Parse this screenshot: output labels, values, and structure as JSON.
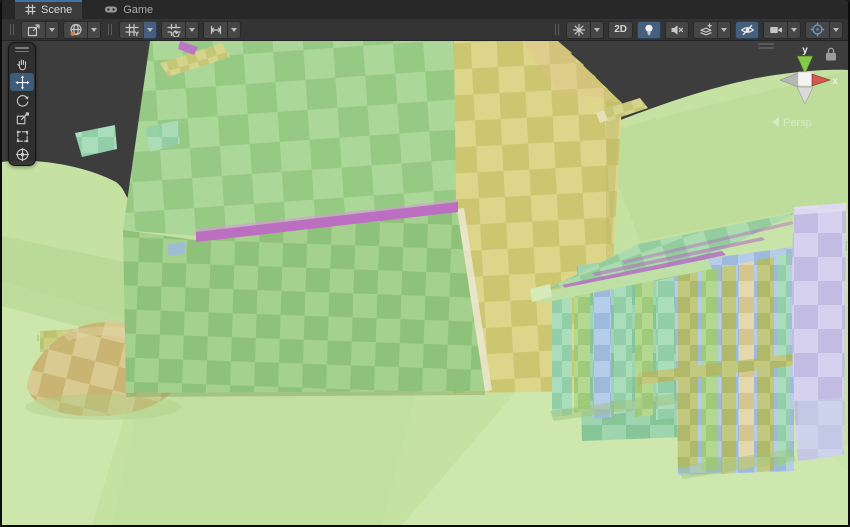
{
  "tabs": {
    "scene": {
      "label": "Scene",
      "active": true
    },
    "game": {
      "label": "Game",
      "active": false
    }
  },
  "scene_toolbar": {
    "tool_settings": {
      "pivot_button": {
        "icon": "pivot-icon",
        "has_dropdown": true
      },
      "orientation_button": {
        "icon": "globe-icon",
        "has_dropdown": true
      }
    },
    "grid_and_snap": {
      "grid_visibility": {
        "icon": "grid-icon",
        "dropdown_active": true
      },
      "grid_snapping": {
        "icon": "grid-snap-icon",
        "has_dropdown": true
      },
      "snap_increment": {
        "icon": "snap-increment-icon",
        "has_dropdown": true
      }
    },
    "view_options": {
      "draw_mode": {
        "icon": "burst-icon",
        "has_dropdown": true
      },
      "two_d": {
        "label": "2D",
        "active": false
      },
      "lighting": {
        "icon": "lightbulb-icon",
        "active": true
      },
      "audio": {
        "icon": "audio-muted-icon",
        "active": false
      },
      "effects": {
        "icon": "effects-icon",
        "has_dropdown": true
      },
      "visibility": {
        "icon": "eye-slash-icon",
        "active": true
      },
      "camera": {
        "icon": "camera-icon",
        "has_dropdown": true
      },
      "gizmos": {
        "icon": "gizmos-icon",
        "has_dropdown": true,
        "icon_color": "#5b9bd8"
      }
    }
  },
  "tools_overlay": {
    "items": [
      {
        "name": "view",
        "icon": "hand-icon",
        "active": false
      },
      {
        "name": "move",
        "icon": "move-icon",
        "active": true
      },
      {
        "name": "rotate",
        "icon": "rotate-icon",
        "active": false
      },
      {
        "name": "scale",
        "icon": "scale-icon",
        "active": false
      },
      {
        "name": "rect",
        "icon": "rect-icon",
        "active": false
      },
      {
        "name": "transform",
        "icon": "transform-icon",
        "active": false
      }
    ]
  },
  "gizmo": {
    "axis_y_label": "y",
    "axis_x_label": "x",
    "projection_label": "Persp",
    "axis_y_color": "#86c94a",
    "axis_x_color": "#cf5a50",
    "locked_icon": "lock-icon"
  },
  "viewport_scene": {
    "background_color": "#3d3d3d",
    "terrain_color": "#c5e2a3",
    "checker_visualization": true,
    "objects": [
      "terrain",
      "farmhouse",
      "shed-fence",
      "lavender-pillar",
      "stone-mound",
      "low-wall",
      "beams"
    ]
  },
  "colors": {
    "tab_active_accent": "#3e74ab",
    "toolbar_bg": "#333333",
    "button_bg": "#464646",
    "button_active_bg": "#44607e",
    "magenta_trim": "#bc6ec0"
  }
}
